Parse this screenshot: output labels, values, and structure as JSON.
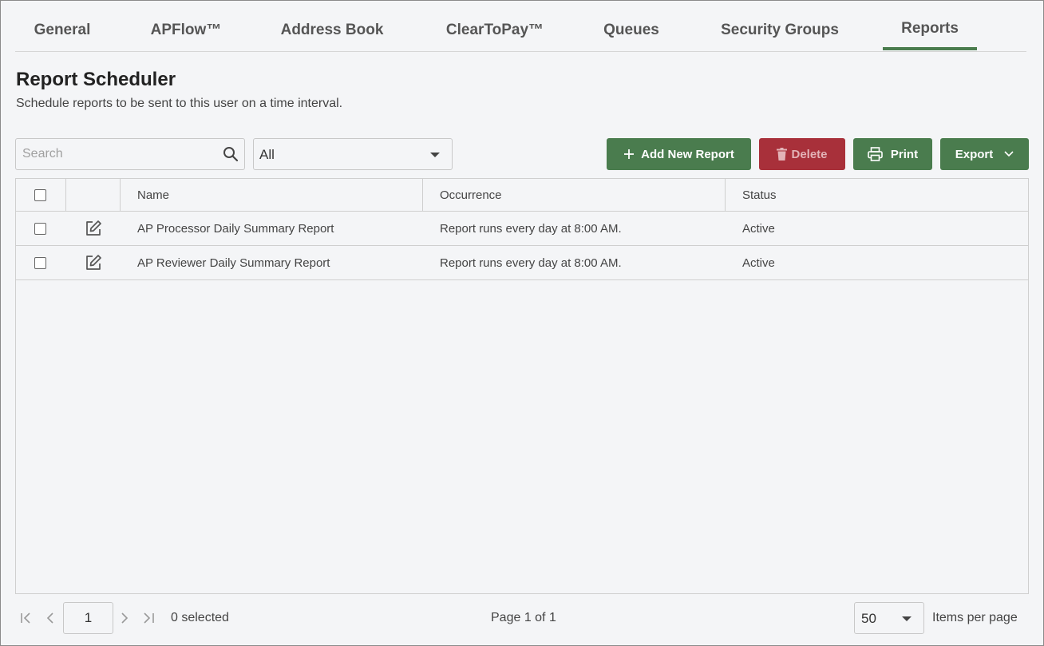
{
  "tabs": [
    {
      "label": "General"
    },
    {
      "label": "APFlow™"
    },
    {
      "label": "Address Book"
    },
    {
      "label": "ClearToPay™"
    },
    {
      "label": "Queues"
    },
    {
      "label": "Security Groups"
    },
    {
      "label": "Reports",
      "active": true
    }
  ],
  "header": {
    "title": "Report Scheduler",
    "subtitle": "Schedule reports to be sent to this user on a time interval."
  },
  "toolbar": {
    "search_placeholder": "Search",
    "search_value": "",
    "filter_value": "All",
    "add_label": "Add New Report",
    "delete_label": "Delete",
    "print_label": "Print",
    "export_label": "Export"
  },
  "grid": {
    "columns": [
      "Name",
      "Occurrence",
      "Status"
    ],
    "rows": [
      {
        "name": "AP Processor Daily Summary Report",
        "occurrence": "Report runs every day at 8:00 AM.",
        "status": "Active"
      },
      {
        "name": "AP Reviewer Daily Summary Report",
        "occurrence": "Report runs every day at 8:00 AM.",
        "status": "Active"
      }
    ]
  },
  "footer": {
    "page_value": "1",
    "selected_text": "0 selected",
    "page_info": "Page 1 of 1",
    "per_page_value": "50",
    "per_page_label": "Items per page"
  },
  "colors": {
    "accent": "#4a7c4e",
    "danger": "#a8303a",
    "background": "#f4f5f7"
  },
  "icons": [
    "search-icon",
    "plus-icon",
    "trash-icon",
    "printer-icon",
    "chevron-down-icon",
    "edit-icon",
    "first-page-icon",
    "prev-page-icon",
    "next-page-icon",
    "last-page-icon"
  ]
}
